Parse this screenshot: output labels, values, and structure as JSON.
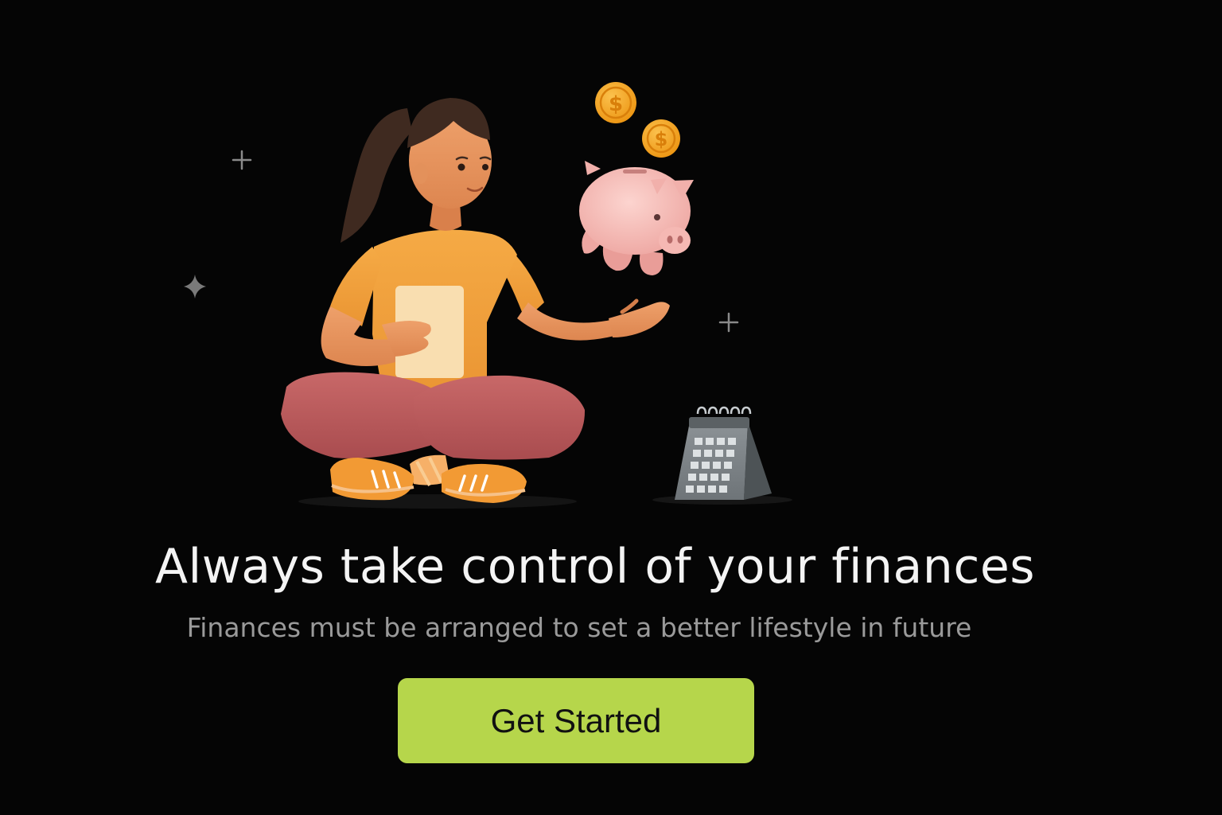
{
  "onboarding": {
    "headline": "Always take control of your finances",
    "subtitle": "Finances must be arranged to set a better lifestyle in future",
    "cta_label": "Get Started"
  },
  "illustration": {
    "elements": [
      "woman-sitting",
      "piggy-bank",
      "coin-icon",
      "calendar-icon",
      "sparkle-icon"
    ],
    "coin_symbol": "$"
  },
  "colors": {
    "background": "#050505",
    "headline": "#f4f4f4",
    "subtitle": "#9a9a9a",
    "cta_background": "#b6d64b",
    "cta_text": "#111111",
    "shirt": "#f2a23c",
    "pants": "#b85a5a",
    "piggy": "#f4b9b5",
    "coin": "#f4a31c"
  }
}
